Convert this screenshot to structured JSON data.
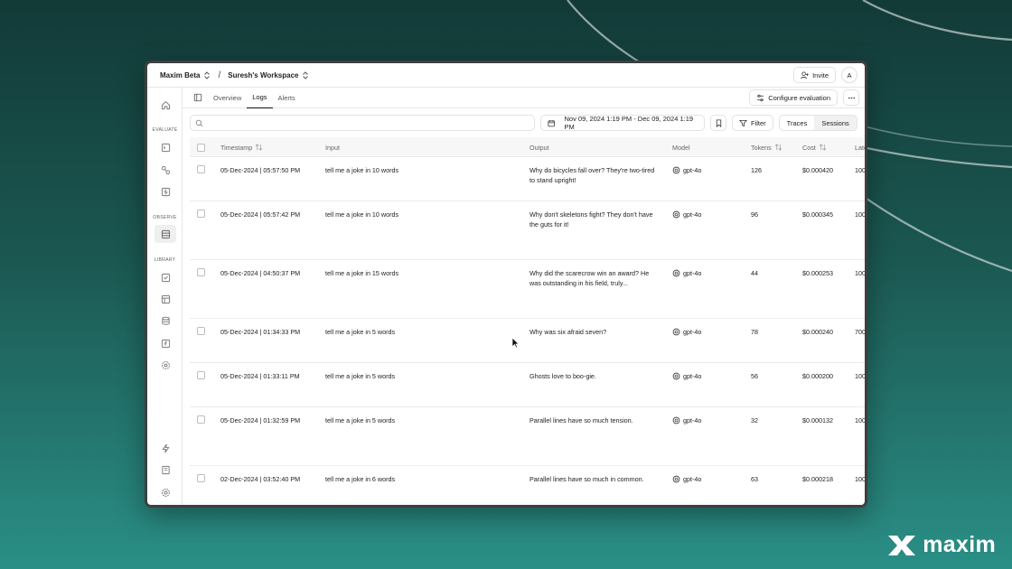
{
  "brand": {
    "name": "maxim"
  },
  "topbar": {
    "org": "Maxim Beta",
    "workspace": "Suresh's Workspace",
    "invite_label": "Invite",
    "avatar_initial": "A"
  },
  "sidebar": {
    "sections": {
      "evaluate": "EVALUATE",
      "observe": "OBSERVE",
      "library": "LIBRARY"
    },
    "items": [
      "home-icon",
      "terminal-icon",
      "workflow-icon",
      "zap-box-icon",
      "logs-icon",
      "checklist-icon",
      "table-icon",
      "database-icon",
      "function-icon",
      "gear-cog-icon",
      "bolt-icon",
      "book-icon",
      "settings-icon"
    ],
    "active": "logs-icon"
  },
  "tabs": [
    {
      "label": "Overview"
    },
    {
      "label": "Logs"
    },
    {
      "label": "Alerts"
    }
  ],
  "active_tab": "Logs",
  "configure_label": "Configure evaluation",
  "search": {
    "value": "",
    "placeholder": ""
  },
  "date_range": "Nov 09, 2024 1:19 PM - Dec 09, 2024 1:19 PM",
  "filter_label": "Filter",
  "view_toggle": {
    "traces": "Traces",
    "sessions": "Sessions",
    "active": "Sessions"
  },
  "table": {
    "columns": {
      "timestamp": "Timestamp",
      "input": "Input",
      "output": "Output",
      "model": "Model",
      "tokens": "Tokens",
      "cost": "Cost",
      "latency": "Late"
    },
    "rows": [
      {
        "timestamp": "05-Dec-2024 | 05:57:50 PM",
        "input": "tell me a joke in 10 words",
        "output": "Why do bicycles fall over? They're two-tired to stand upright!",
        "model": "gpt-4o",
        "tokens": "126",
        "cost": "$0.000420",
        "latency": "100"
      },
      {
        "timestamp": "05-Dec-2024 | 05:57:42 PM",
        "input": "tell me a joke in 10 words",
        "output": "Why don't skeletons fight? They don't have the guts for it!",
        "model": "gpt-4o",
        "tokens": "96",
        "cost": "$0.000345",
        "latency": "100"
      },
      {
        "timestamp": "05-Dec-2024 | 04:50:37 PM",
        "input": "tell me a joke in 15 words",
        "output": "Why did the scarecrow win an award? He was outstanding in his field, truly...",
        "model": "gpt-4o",
        "tokens": "44",
        "cost": "$0.000253",
        "latency": "100"
      },
      {
        "timestamp": "05-Dec-2024 | 01:34:33 PM",
        "input": "tell me a joke in 5 words",
        "output": "Why was six afraid seven?",
        "model": "gpt-4o",
        "tokens": "78",
        "cost": "$0.000240",
        "latency": "700"
      },
      {
        "timestamp": "05-Dec-2024 | 01:33:11 PM",
        "input": "tell me a joke in 5 words",
        "output": "Ghosts love to boo-gie.",
        "model": "gpt-4o",
        "tokens": "56",
        "cost": "$0.000200",
        "latency": "100"
      },
      {
        "timestamp": "05-Dec-2024 | 01:32:59 PM",
        "input": "tell me a joke in 5 words",
        "output": "Parallel lines have so much tension.",
        "model": "gpt-4o",
        "tokens": "32",
        "cost": "$0.000132",
        "latency": "100"
      },
      {
        "timestamp": "02-Dec-2024 | 03:52:40 PM",
        "input": "tell me a joke in 6 words",
        "output": "Parallel lines have so much in common.",
        "model": "gpt-4o",
        "tokens": "63",
        "cost": "$0.000218",
        "latency": "100"
      }
    ]
  },
  "colors": {
    "background_top": "#123a37",
    "background_bottom": "#2a8f86",
    "border": "#e6e6e6",
    "text": "#222222"
  }
}
